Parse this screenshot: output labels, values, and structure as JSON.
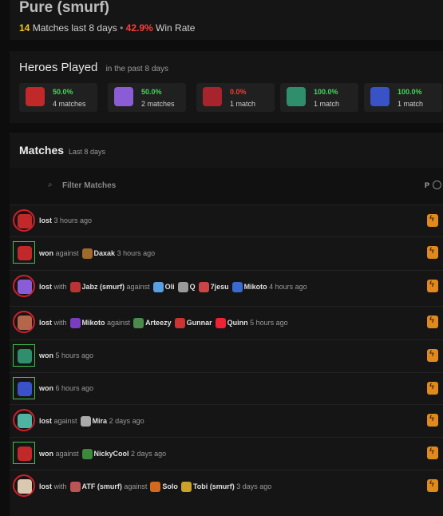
{
  "header": {
    "title": "Pure (smurf)",
    "matches_count": "14",
    "matches_label": "Matches last 8 days",
    "separator": "•",
    "win_rate": "42.9%",
    "win_rate_label": "Win Rate"
  },
  "heroes": {
    "title": "Heroes Played",
    "subtitle": "in the past 8 days",
    "items": [
      {
        "win_rate": "50.0%",
        "matches": "4 matches",
        "result": "green",
        "icon": "red-demon-icon"
      },
      {
        "win_rate": "50.0%",
        "matches": "2 matches",
        "result": "green",
        "icon": "purple-spirit-icon"
      },
      {
        "win_rate": "0.0%",
        "matches": "1 match",
        "result": "red",
        "icon": "crimson-crab-icon"
      },
      {
        "win_rate": "100.0%",
        "matches": "1 match",
        "result": "green",
        "icon": "teal-beast-icon"
      },
      {
        "win_rate": "100.0%",
        "matches": "1 match",
        "result": "green",
        "icon": "blue-knight-icon"
      }
    ]
  },
  "matches": {
    "title": "Matches",
    "subtitle": "Last 8 days",
    "filter_placeholder": "Filter Matches",
    "column_label": "P",
    "rows": [
      {
        "result": "lost",
        "hero_icon": "red-demon-icon",
        "parts": [
          {
            "t": "lost",
            "b": true
          },
          {
            "t": " 3 hours ago"
          }
        ]
      },
      {
        "result": "won",
        "hero_icon": "red-demon-icon",
        "parts": [
          {
            "t": "won",
            "b": true
          },
          {
            "t": " against"
          },
          {
            "m": "#a06a2a"
          },
          {
            "t": "Daxak",
            "b": true
          },
          {
            "t": " 3 hours ago"
          }
        ]
      },
      {
        "result": "lost",
        "hero_icon": "purple-spirit-icon",
        "parts": [
          {
            "t": "lost",
            "b": true
          },
          {
            "t": " with"
          },
          {
            "m": "#b33"
          },
          {
            "t": "Jabz (smurf)",
            "b": true
          },
          {
            "t": " against"
          },
          {
            "m": "#5aa0e0"
          },
          {
            "t": "Oli",
            "b": true
          },
          {
            "m": "#999"
          },
          {
            "t": "Q",
            "b": true
          },
          {
            "m": "#c44"
          },
          {
            "t": "7jesu",
            "b": true
          },
          {
            "m": "#3a6ad0"
          },
          {
            "t": "Mikoto",
            "b": true
          },
          {
            "t": " 4 hours ago"
          }
        ]
      },
      {
        "result": "lost",
        "hero_icon": "skull-maw-icon",
        "parts": [
          {
            "t": "lost",
            "b": true
          },
          {
            "t": " with"
          },
          {
            "m": "#7a3cc0"
          },
          {
            "t": "Mikoto",
            "b": true
          },
          {
            "t": " against"
          },
          {
            "m": "#4a8a4a"
          },
          {
            "t": "Arteezy",
            "b": true
          },
          {
            "m": "#c33"
          },
          {
            "t": "Gunnar",
            "b": true
          },
          {
            "m": "#e23"
          },
          {
            "t": "Quinn",
            "b": true
          },
          {
            "t": " 5 hours ago"
          }
        ]
      },
      {
        "result": "won",
        "hero_icon": "teal-beast-icon",
        "parts": [
          {
            "t": "won",
            "b": true
          },
          {
            "t": " 5 hours ago"
          }
        ]
      },
      {
        "result": "won",
        "hero_icon": "blue-knight-icon",
        "parts": [
          {
            "t": "won",
            "b": true
          },
          {
            "t": " 6 hours ago"
          }
        ]
      },
      {
        "result": "lost",
        "hero_icon": "teal-woman-icon",
        "parts": [
          {
            "t": "lost",
            "b": true
          },
          {
            "t": " against"
          },
          {
            "m": "#aaa"
          },
          {
            "t": "Mira",
            "b": true
          },
          {
            "t": " 2 days ago"
          }
        ]
      },
      {
        "result": "won",
        "hero_icon": "red-demon-icon",
        "parts": [
          {
            "t": "won",
            "b": true
          },
          {
            "t": " against"
          },
          {
            "m": "#3a8a3a"
          },
          {
            "t": "NickyCool",
            "b": true
          },
          {
            "t": " 2 days ago"
          }
        ]
      },
      {
        "result": "lost",
        "hero_icon": "clown-icon",
        "parts": [
          {
            "t": "lost",
            "b": true
          },
          {
            "t": " with"
          },
          {
            "m": "#b55"
          },
          {
            "t": "ATF (smurf)",
            "b": true
          },
          {
            "t": " against"
          },
          {
            "m": "#d2691e"
          },
          {
            "t": "Solo",
            "b": true
          },
          {
            "m": "#c9a227"
          },
          {
            "t": "Tobi (smurf)",
            "b": true
          },
          {
            "t": " 3 days ago"
          }
        ]
      }
    ]
  },
  "colors": {
    "win": "#3ddc53",
    "loss": "#ff3535",
    "count": "#f5c518",
    "bolt": "#e08a1e"
  },
  "icon_colors": {
    "red-demon-icon": "#c0282a",
    "purple-spirit-icon": "#8a5cd6",
    "crimson-crab-icon": "#a8242c",
    "teal-beast-icon": "#2f8f6c",
    "blue-knight-icon": "#3a52c8",
    "skull-maw-icon": "#b5654a",
    "teal-woman-icon": "#4fb3a2",
    "clown-icon": "#d8c9b0"
  }
}
